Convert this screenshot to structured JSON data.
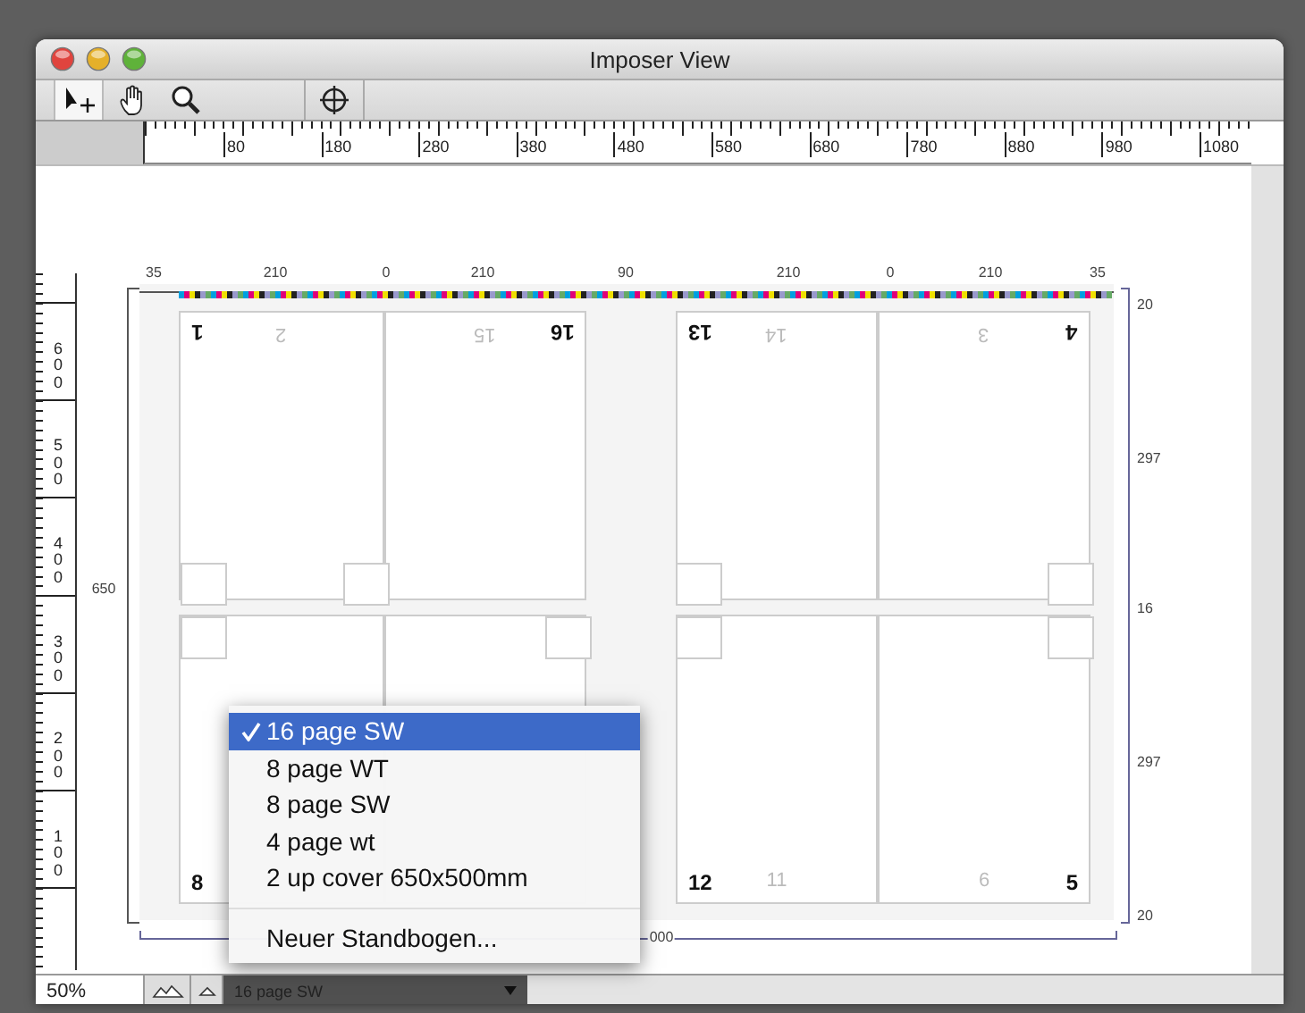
{
  "window": {
    "title": "Imposer View"
  },
  "toolbar": {
    "tools": [
      {
        "kind": "select",
        "selected": true
      },
      {
        "kind": "hand",
        "selected": false
      },
      {
        "kind": "zoom",
        "selected": false
      },
      {
        "kind": "crosshair",
        "selected": false
      }
    ]
  },
  "ruler": {
    "labels": [
      "80",
      "180",
      "280",
      "380",
      "480",
      "580",
      "680",
      "780",
      "880",
      "980",
      "1080"
    ]
  },
  "vertical_ruler": {
    "labels": [
      "600",
      "500",
      "400",
      "300",
      "200",
      "100"
    ]
  },
  "sheet": {
    "top_dimensions": [
      "35",
      "210",
      "0",
      "210",
      "90",
      "210",
      "0",
      "210",
      "35"
    ],
    "right_dimensions": [
      "20",
      "297",
      "16",
      "297",
      "20"
    ],
    "height_label": "650",
    "width_label": "000",
    "top_row": [
      {
        "kind": "page",
        "numbers": [
          {
            "text": "1",
            "faint": false,
            "rotated": true
          },
          {
            "text": "2",
            "faint": true,
            "rotated": true
          }
        ]
      },
      {
        "kind": "page",
        "numbers": [
          {
            "text": "15",
            "faint": true,
            "rotated": true
          },
          {
            "text": "16",
            "faint": false,
            "rotated": true
          }
        ]
      },
      {
        "kind": "page",
        "numbers": [
          {
            "text": "13",
            "faint": false,
            "rotated": true
          },
          {
            "text": "14",
            "faint": true,
            "rotated": true
          }
        ]
      },
      {
        "kind": "page",
        "numbers": [
          {
            "text": "3",
            "faint": true,
            "rotated": true
          },
          {
            "text": "4",
            "faint": false,
            "rotated": true
          }
        ]
      }
    ],
    "bottom_row": [
      {
        "kind": "page",
        "numbers": [
          {
            "text": "8",
            "faint": false,
            "rotated": false
          }
        ]
      },
      {
        "kind": "page"
      },
      {
        "kind": "page",
        "numbers": [
          {
            "text": "12",
            "faint": false,
            "rotated": false
          },
          {
            "text": "11",
            "faint": true,
            "rotated": false
          }
        ]
      },
      {
        "kind": "page",
        "numbers": [
          {
            "text": "6",
            "faint": true,
            "rotated": false
          },
          {
            "text": "5",
            "faint": false,
            "rotated": false
          }
        ]
      }
    ]
  },
  "menu": {
    "items": [
      {
        "label": "16 page SW",
        "selected": true
      },
      {
        "label": "8 page WT",
        "selected": false
      },
      {
        "label": "8 page SW",
        "selected": false
      },
      {
        "label": "4 page wt",
        "selected": false
      },
      {
        "label": "2 up cover 650x500mm",
        "selected": false
      }
    ],
    "footer": "Neuer Standbogen..."
  },
  "status_bar": {
    "zoom": "50%",
    "popup": "16 page SW"
  }
}
